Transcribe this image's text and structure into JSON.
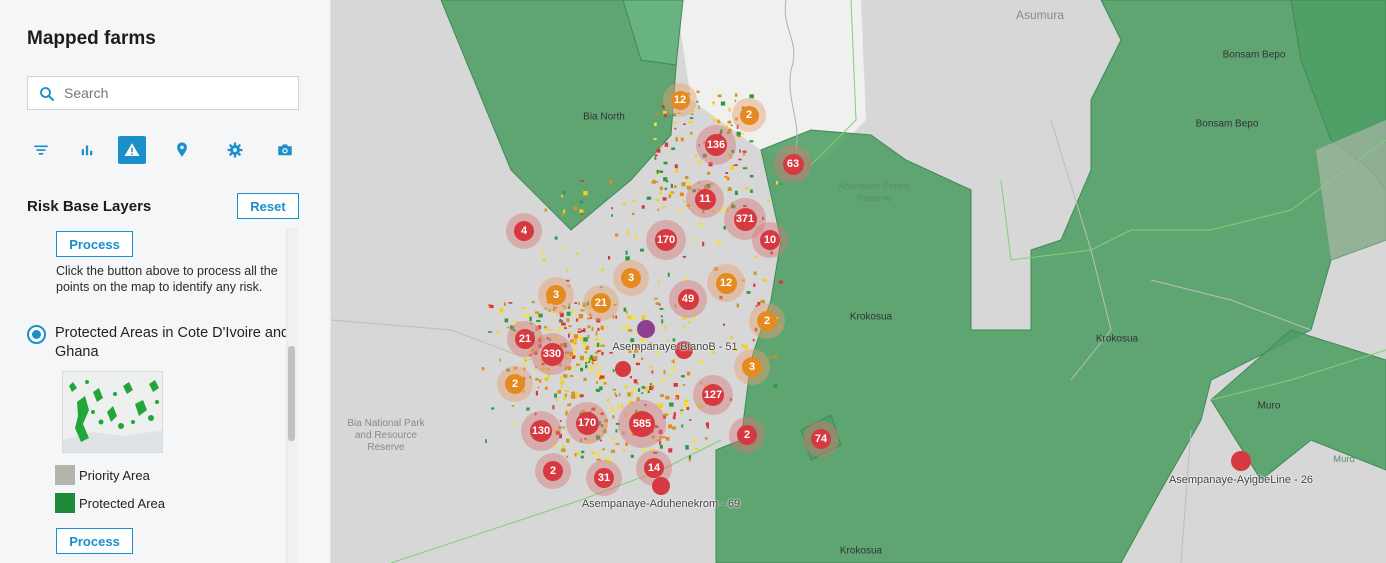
{
  "sidebar": {
    "title": "Mapped farms",
    "search_placeholder": "Search",
    "toolbar": [
      {
        "name": "filter-icon",
        "active": false
      },
      {
        "name": "bar-chart-icon",
        "active": false
      },
      {
        "name": "warning-icon",
        "active": true
      },
      {
        "name": "location-pin-icon",
        "active": false
      },
      {
        "name": "gear-icon",
        "active": false
      },
      {
        "name": "camera-icon",
        "active": false
      }
    ],
    "section_title": "Risk Base Layers",
    "reset_label": "Reset",
    "process_label": "Process",
    "process_description": "Click the button above to process all the points on the map to identify any risk.",
    "layer_name": "Protected Areas in Cote D'Ivoire and Ghana",
    "legend": [
      {
        "label": "Priority Area",
        "color": "#b4b6ae"
      },
      {
        "label": "Protected Area",
        "color": "#1f8a3a"
      }
    ],
    "accent_color": "#1a8fc9"
  },
  "map": {
    "places": [
      {
        "name": "Bia North"
      },
      {
        "name": "Bonsam Bepo"
      },
      {
        "name": "Bonsam Bepo"
      },
      {
        "name": "Asumura"
      },
      {
        "name": "Aboniyere Forest Reserve"
      },
      {
        "name": "Krokosua"
      },
      {
        "name": "Krokosua"
      },
      {
        "name": "Krokosua"
      },
      {
        "name": "Muro"
      },
      {
        "name": "Muro"
      },
      {
        "name": "Bia National Park and Resource Reserve"
      }
    ],
    "clusters": [
      {
        "count": "12",
        "color": "orange"
      },
      {
        "count": "2",
        "color": "orange"
      },
      {
        "count": "136",
        "color": "red"
      },
      {
        "count": "63",
        "color": "red"
      },
      {
        "count": "11",
        "color": "red"
      },
      {
        "count": "371",
        "color": "red"
      },
      {
        "count": "10",
        "color": "red"
      },
      {
        "count": "4",
        "color": "red"
      },
      {
        "count": "170",
        "color": "red"
      },
      {
        "count": "3",
        "color": "orange"
      },
      {
        "count": "3",
        "color": "orange"
      },
      {
        "count": "21",
        "color": "orange"
      },
      {
        "count": "49",
        "color": "red"
      },
      {
        "count": "12",
        "color": "orange"
      },
      {
        "count": "2",
        "color": "orange"
      },
      {
        "count": "21",
        "color": "red"
      },
      {
        "count": "330",
        "color": "red"
      },
      {
        "count": "3",
        "color": "orange"
      },
      {
        "count": "2",
        "color": "orange"
      },
      {
        "count": "127",
        "color": "red"
      },
      {
        "count": "130",
        "color": "red"
      },
      {
        "count": "170",
        "color": "red"
      },
      {
        "count": "585",
        "color": "red"
      },
      {
        "count": "2",
        "color": "red"
      },
      {
        "count": "74",
        "color": "red"
      },
      {
        "count": "14",
        "color": "red"
      },
      {
        "count": "2",
        "color": "red"
      },
      {
        "count": "31",
        "color": "red"
      }
    ],
    "marker_labels": [
      "Asempanaye-BianoB - 51",
      "Asempanaye-Aduhenekrom - 69",
      "Asempanaye-AyigbeLine - 26"
    ]
  }
}
